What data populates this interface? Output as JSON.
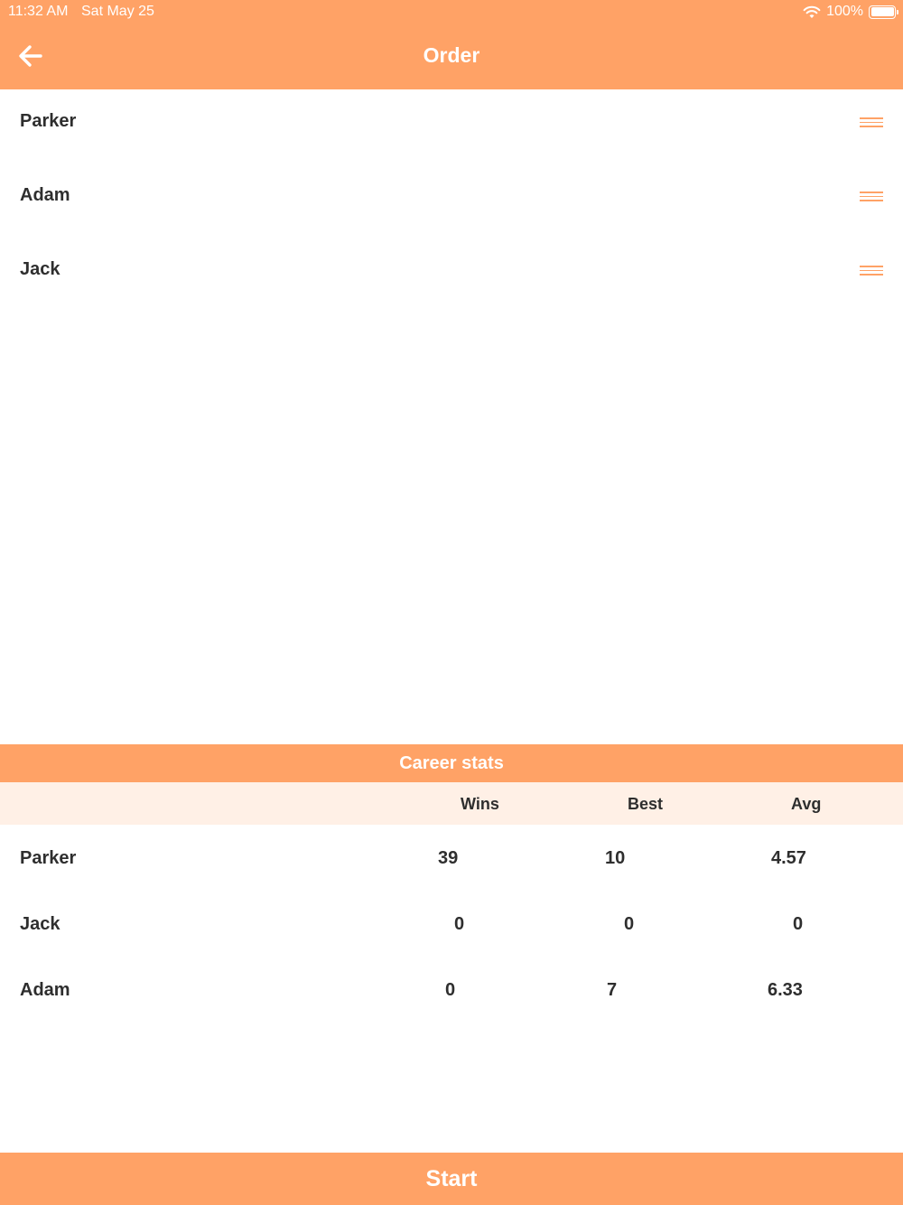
{
  "status_bar": {
    "time": "11:32 AM",
    "date": "Sat May 25",
    "battery": "100%",
    "wifi_icon": "wifi-icon",
    "battery_icon": "battery-icon"
  },
  "nav": {
    "title": "Order",
    "back_icon": "arrow-left-icon"
  },
  "order": {
    "players": [
      {
        "name": "Parker"
      },
      {
        "name": "Adam"
      },
      {
        "name": "Jack"
      }
    ],
    "handle_icon": "drag-handle-icon"
  },
  "career_stats": {
    "title": "Career stats",
    "columns": [
      "Wins",
      "Best",
      "Avg"
    ],
    "rows": [
      {
        "name": "Parker",
        "wins": "39",
        "best": "10",
        "avg": "4.57"
      },
      {
        "name": "Jack",
        "wins": "0",
        "best": "0",
        "avg": "0"
      },
      {
        "name": "Adam",
        "wins": "0",
        "best": "7",
        "avg": "6.33"
      }
    ]
  },
  "start_label": "Start",
  "colors": {
    "accent": "#ffa266",
    "header_tint": "#fff0e6",
    "text": "#2e2e2e"
  }
}
